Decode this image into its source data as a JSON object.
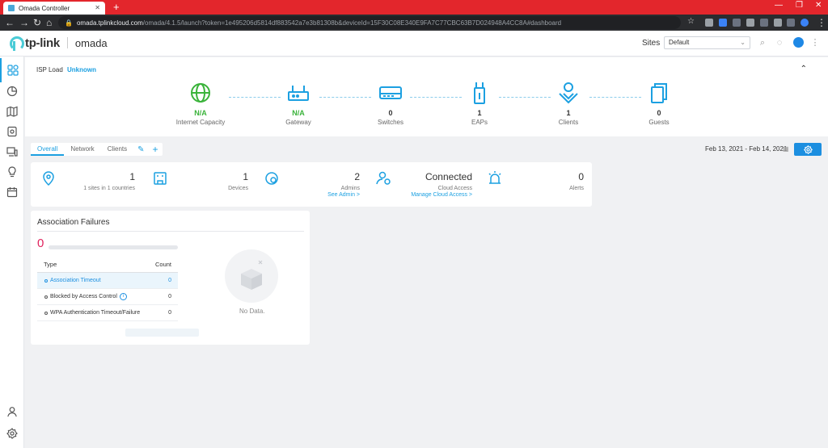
{
  "browser": {
    "tab_title": "Omada Controller",
    "tab_close": "✕",
    "new_tab": "+",
    "url_host": "omada.tplinkcloud.com",
    "url_path": "/omada/4.1.5/launch?token=1e495206d5814df883542a7e3b81308b&deviceId=15F30C08E340E9FA7C77CBC63B7D024948A4CC8A#dashboard",
    "win_minimize": "—",
    "win_restore": "❐",
    "win_close": "✕"
  },
  "header": {
    "brand": "tp-link",
    "product": "omada",
    "sites_label": "Sites",
    "site_selected": "Default"
  },
  "isp": {
    "label": "ISP Load",
    "value": "Unknown"
  },
  "topology": [
    {
      "value": "N/A",
      "label": "Internet Capacity",
      "icon": "globe-icon"
    },
    {
      "value": "N/A",
      "label": "Gateway",
      "icon": "router-icon"
    },
    {
      "value": "0",
      "label": "Switches",
      "icon": "switch-icon"
    },
    {
      "value": "1",
      "label": "EAPs",
      "icon": "access-point-icon"
    },
    {
      "value": "1",
      "label": "Clients",
      "icon": "client-icon"
    },
    {
      "value": "0",
      "label": "Guests",
      "icon": "guest-icon"
    }
  ],
  "tabs": {
    "overall": "Overall",
    "network": "Network",
    "clients": "Clients"
  },
  "date_range": "Feb 13, 2021 - Feb 14, 2021",
  "stats": {
    "sites_count": "1",
    "sites_sub": "1 sites in 1 countries",
    "devices_count": "1",
    "devices_label": "Devices",
    "admins_count": "2",
    "admins_label": "Admins",
    "admins_link": "See Admin >",
    "cloud_status": "Connected",
    "cloud_label": "Cloud Access",
    "cloud_link": "Manage Cloud Access >",
    "alerts_count": "0",
    "alerts_label": "Alerts"
  },
  "assoc": {
    "title": "Association Failures",
    "total": "0",
    "col_type": "Type",
    "col_count": "Count",
    "rows": [
      {
        "type": "Association Timeout",
        "count": "0"
      },
      {
        "type": "Blocked by Access Control",
        "count": "0"
      },
      {
        "type": "WPA Authentication Timeout/Failure",
        "count": "0"
      }
    ],
    "no_data": "No Data."
  },
  "colors": {
    "accent": "#1ca0e1",
    "green": "#3ab33a",
    "alert_red": "#e0245e",
    "chrome_red": "#e3262c"
  }
}
